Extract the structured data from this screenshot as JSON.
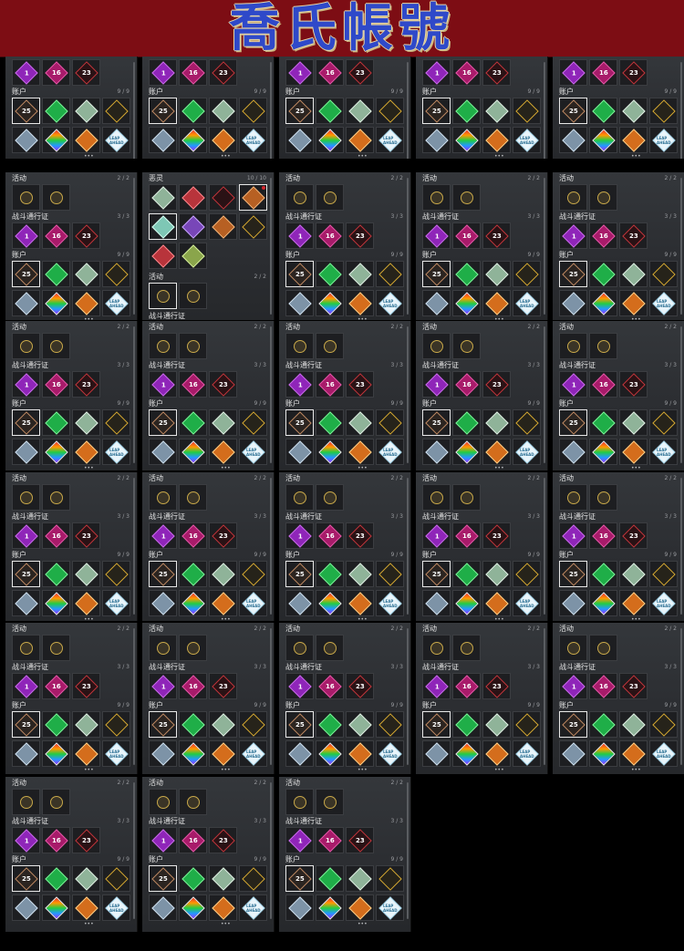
{
  "banner": {
    "title": "喬氏帳號"
  },
  "labels": {
    "activity": "活动",
    "battle_pass": "战斗通行证",
    "account": "账户",
    "evil": "恶灵"
  },
  "counts": {
    "activity": "2 / 2",
    "battle_pass": "3 / 3",
    "account": "9 / 9",
    "evil": "10 / 10"
  },
  "tiles": {
    "bp1": "1",
    "bp2": "16",
    "bp3": "23",
    "acc1": "25",
    "white_badge": "LEAP AHEAD"
  },
  "more": "•••"
}
